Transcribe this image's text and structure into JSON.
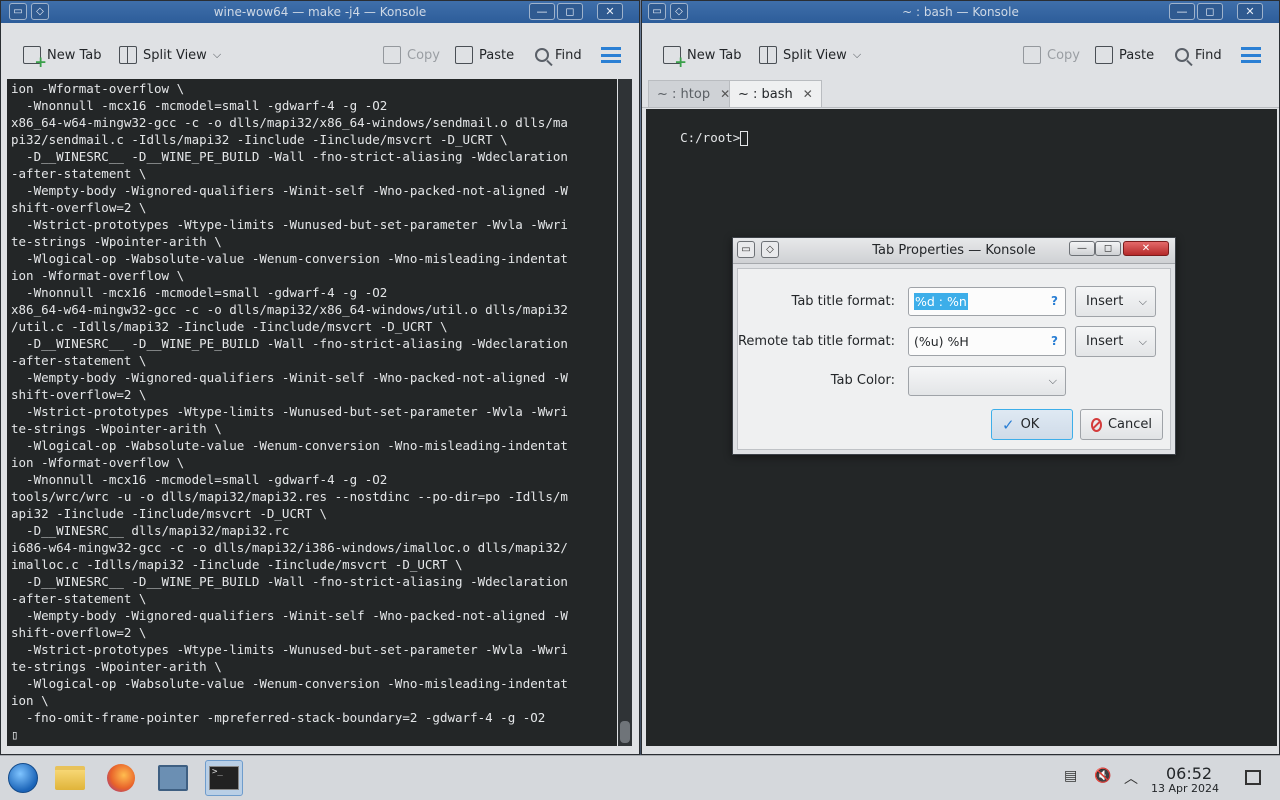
{
  "left_window": {
    "title": "wine-wow64 — make -j4 — Konsole",
    "toolbar": {
      "new_tab": "New Tab",
      "split_view": "Split View",
      "copy": "Copy",
      "paste": "Paste",
      "find": "Find"
    },
    "terminal_lines": [
      "ion -Wformat-overflow \\",
      "  -Wnonnull -mcx16 -mcmodel=small -gdwarf-4 -g -O2",
      "x86_64-w64-mingw32-gcc -c -o dlls/mapi32/x86_64-windows/sendmail.o dlls/ma",
      "pi32/sendmail.c -Idlls/mapi32 -Iinclude -Iinclude/msvcrt -D_UCRT \\",
      "  -D__WINESRC__ -D__WINE_PE_BUILD -Wall -fno-strict-aliasing -Wdeclaration",
      "-after-statement \\",
      "  -Wempty-body -Wignored-qualifiers -Winit-self -Wno-packed-not-aligned -W",
      "shift-overflow=2 \\",
      "  -Wstrict-prototypes -Wtype-limits -Wunused-but-set-parameter -Wvla -Wwri",
      "te-strings -Wpointer-arith \\",
      "  -Wlogical-op -Wabsolute-value -Wenum-conversion -Wno-misleading-indentat",
      "ion -Wformat-overflow \\",
      "  -Wnonnull -mcx16 -mcmodel=small -gdwarf-4 -g -O2",
      "x86_64-w64-mingw32-gcc -c -o dlls/mapi32/x86_64-windows/util.o dlls/mapi32",
      "/util.c -Idlls/mapi32 -Iinclude -Iinclude/msvcrt -D_UCRT \\",
      "  -D__WINESRC__ -D__WINE_PE_BUILD -Wall -fno-strict-aliasing -Wdeclaration",
      "-after-statement \\",
      "  -Wempty-body -Wignored-qualifiers -Winit-self -Wno-packed-not-aligned -W",
      "shift-overflow=2 \\",
      "  -Wstrict-prototypes -Wtype-limits -Wunused-but-set-parameter -Wvla -Wwri",
      "te-strings -Wpointer-arith \\",
      "  -Wlogical-op -Wabsolute-value -Wenum-conversion -Wno-misleading-indentat",
      "ion -Wformat-overflow \\",
      "  -Wnonnull -mcx16 -mcmodel=small -gdwarf-4 -g -O2",
      "tools/wrc/wrc -u -o dlls/mapi32/mapi32.res --nostdinc --po-dir=po -Idlls/m",
      "api32 -Iinclude -Iinclude/msvcrt -D_UCRT \\",
      "  -D__WINESRC__ dlls/mapi32/mapi32.rc",
      "i686-w64-mingw32-gcc -c -o dlls/mapi32/i386-windows/imalloc.o dlls/mapi32/",
      "imalloc.c -Idlls/mapi32 -Iinclude -Iinclude/msvcrt -D_UCRT \\",
      "  -D__WINESRC__ -D__WINE_PE_BUILD -Wall -fno-strict-aliasing -Wdeclaration",
      "-after-statement \\",
      "  -Wempty-body -Wignored-qualifiers -Winit-self -Wno-packed-not-aligned -W",
      "shift-overflow=2 \\",
      "  -Wstrict-prototypes -Wtype-limits -Wunused-but-set-parameter -Wvla -Wwri",
      "te-strings -Wpointer-arith \\",
      "  -Wlogical-op -Wabsolute-value -Wenum-conversion -Wno-misleading-indentat",
      "ion \\",
      "  -fno-omit-frame-pointer -mpreferred-stack-boundary=2 -gdwarf-4 -g -O2",
      "▯"
    ]
  },
  "right_window": {
    "title": "~ : bash — Konsole",
    "toolbar": {
      "new_tab": "New Tab",
      "split_view": "Split View",
      "copy": "Copy",
      "paste": "Paste",
      "find": "Find"
    },
    "tabs": [
      {
        "label": "~ : htop",
        "active": false
      },
      {
        "label": "~ : bash",
        "active": true
      }
    ],
    "prompt": "C:/root>"
  },
  "dialog": {
    "title": "Tab Properties — Konsole",
    "tab_title_format_label": "Tab title format:",
    "tab_title_format_value": "%d : %n",
    "remote_tab_title_format_label": "Remote tab title format:",
    "remote_tab_title_format_value": "(%u) %H",
    "insert_label": "Insert",
    "tab_color_label": "Tab Color:",
    "help_glyph": "?",
    "ok_label": "OK",
    "cancel_label": "Cancel"
  },
  "taskbar": {
    "time": "06:52",
    "date": "13 Apr 2024"
  },
  "colors": {
    "accent": "#3daee9",
    "terminal_bg": "#232627",
    "titlebar_active": "#2d5d9a"
  }
}
